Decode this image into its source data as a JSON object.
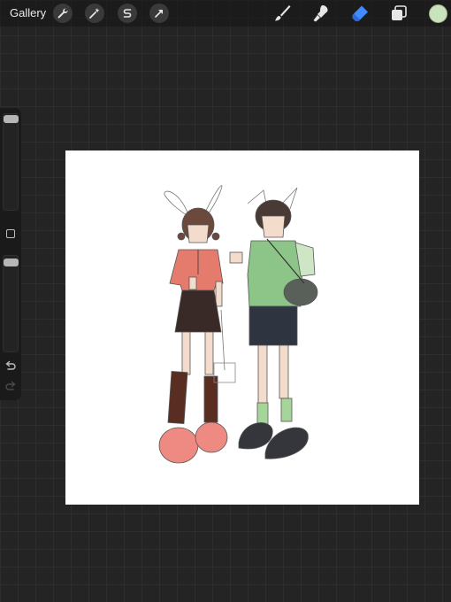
{
  "topbar": {
    "gallery_label": "Gallery",
    "left_tools": [
      "wrench-icon",
      "magic-wand-icon",
      "selection-s-icon",
      "transform-arrow-icon"
    ],
    "right_tools": [
      "brush-icon",
      "smudge-icon",
      "eraser-icon",
      "layers-icon"
    ],
    "active_tool": "eraser-icon",
    "current_color": "#c9e3bd",
    "active_tool_color": "#3f8bff"
  },
  "sidebar": {
    "size_slider_level": 0.0,
    "opacity_slider_level": 0.0,
    "controls": [
      "modify-button",
      "undo-icon",
      "redo-icon"
    ]
  },
  "artwork": {
    "girl": {
      "shirt_color": "#e57b6c",
      "skirt_color": "#3a2a27",
      "socks_color": "#5a2d22",
      "shoes_color": "#ee8a82"
    },
    "boy": {
      "vest_color": "#8cc587",
      "shorts_color": "#2f3540",
      "socks_color": "#a6d59a",
      "shoes_color": "#34363c"
    }
  }
}
